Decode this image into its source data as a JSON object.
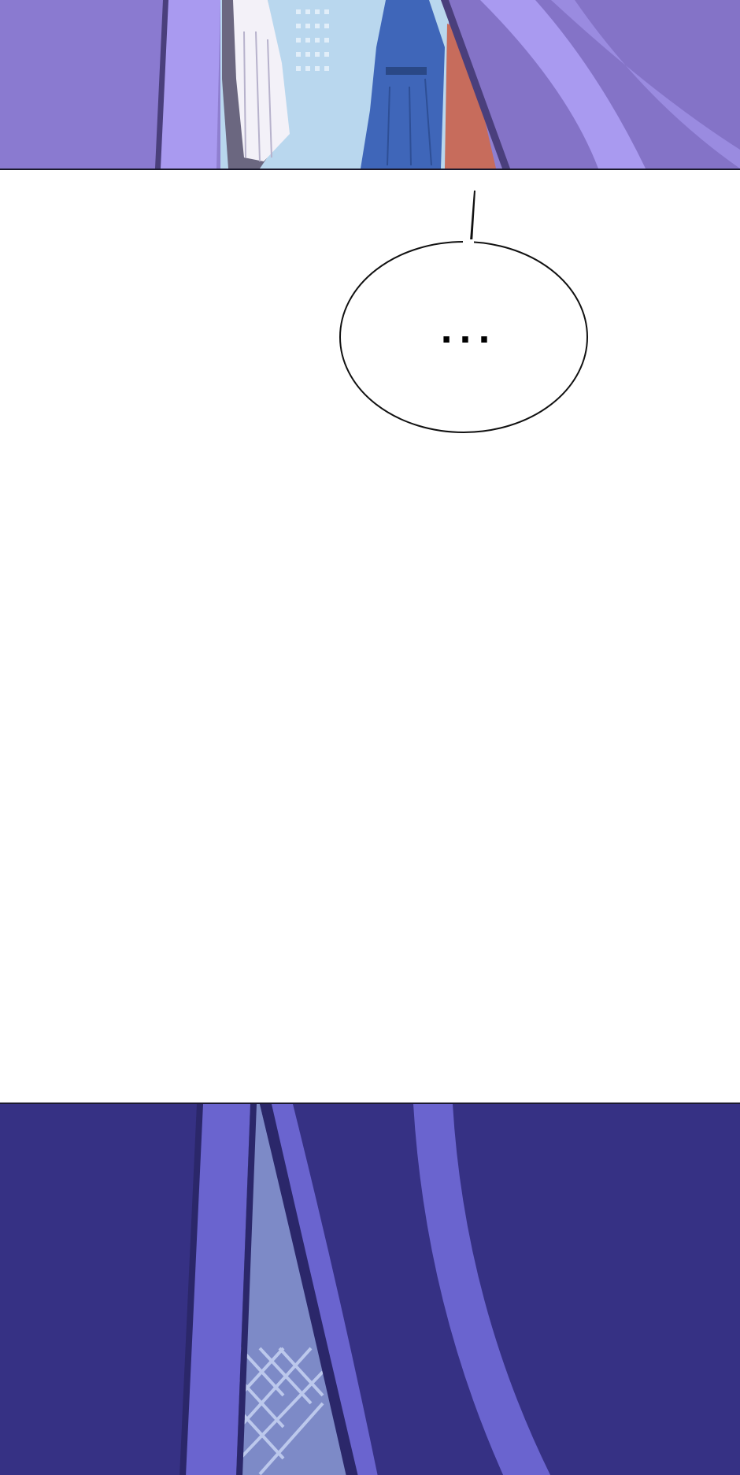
{
  "comic": {
    "top_panel": {
      "description": "",
      "palette": {
        "left_wall": "#8a7ad0",
        "pillar": "#a99af0",
        "pillar_shadow": "#4a3f7c",
        "sky": "#b9d7ee",
        "robe_left": "#f3f1f8",
        "robe_left_shadow": "#6b6780",
        "robe_blue": "#3f66b9",
        "robe_red": "#c76c5c",
        "right_arch": "#8473c7",
        "right_arch_light": "#a99af0"
      }
    },
    "speech_bubble": {
      "text": "..."
    },
    "bottom_panel": {
      "palette": {
        "base": "#363184",
        "pillar": "#6a64cf",
        "pillar_dark": "#2b276a",
        "screen_bg": "#7d8ac7",
        "lattice": "#bcc8ec"
      }
    }
  }
}
